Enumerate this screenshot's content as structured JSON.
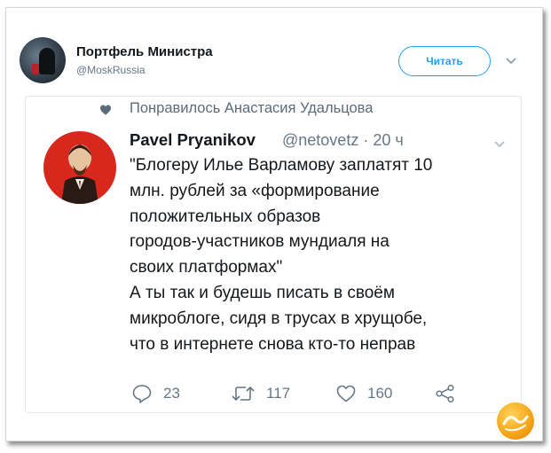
{
  "account": {
    "name": "Портфель Министра",
    "handle": "@MoskRussia",
    "follow_label": "Читать"
  },
  "tweet": {
    "liked_by": "Понравилось Анастасия Удальцова",
    "author": "Pavel Pryanikov",
    "meta": "@netovetz · 20 ч",
    "lines": [
      "\"Блогеру Илье Варламову заплатят 10",
      "млн. рублей за «формирование",
      "положительных образов",
      "городов-участников мундиаля на",
      "своих платформах\"",
      "А ты так и будешь писать в своём",
      "микроблоге, сидя в трусах в хрущобе,",
      "что в интернете снова кто-то неправ"
    ],
    "stats": {
      "replies": "23",
      "retweets": "117",
      "likes": "160"
    }
  },
  "colors": {
    "accent": "#1da1f2",
    "muted": "#657786",
    "avatar_red": "#d8271d"
  }
}
